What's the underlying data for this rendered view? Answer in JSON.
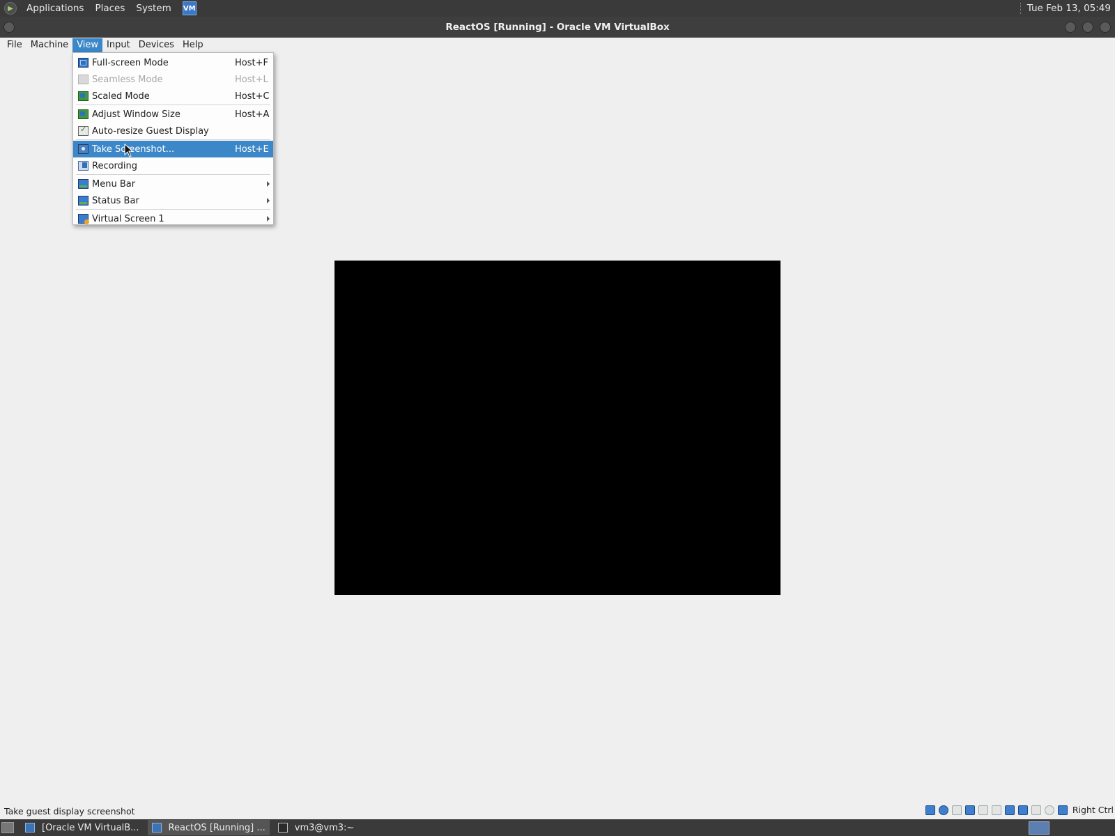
{
  "top_panel": {
    "menus": [
      "Applications",
      "Places",
      "System"
    ],
    "clock": "Tue Feb 13, 05:49"
  },
  "window": {
    "title": "ReactOS [Running] - Oracle VM VirtualBox"
  },
  "menubar": {
    "items": [
      "File",
      "Machine",
      "View",
      "Input",
      "Devices",
      "Help"
    ],
    "active": "View"
  },
  "view_menu": {
    "items": [
      {
        "label": "Full-screen Mode",
        "shortcut": "Host+F",
        "icon": "fullscreen-icon"
      },
      {
        "label": "Seamless Mode",
        "shortcut": "Host+L",
        "icon": "seamless-icon",
        "disabled": true
      },
      {
        "label": "Scaled Mode",
        "shortcut": "Host+C",
        "icon": "scaled-icon"
      },
      {
        "label": "Adjust Window Size",
        "shortcut": "Host+A",
        "icon": "adjust-window-icon"
      },
      {
        "label": "Auto-resize Guest Display",
        "shortcut": "",
        "icon": "auto-resize-icon"
      },
      {
        "label": "Take Screenshot...",
        "shortcut": "Host+E",
        "icon": "screenshot-icon",
        "highlighted": true
      },
      {
        "label": "Recording",
        "shortcut": "",
        "icon": "recording-icon"
      },
      {
        "label": "Menu Bar",
        "shortcut": "",
        "icon": "menu-bar-icon",
        "submenu": true
      },
      {
        "label": "Status Bar",
        "shortcut": "",
        "icon": "status-bar-icon",
        "submenu": true
      },
      {
        "label": "Virtual Screen 1",
        "shortcut": "",
        "icon": "virtual-screen-icon",
        "submenu": true
      }
    ]
  },
  "statusbar": {
    "text": "Take guest display screenshot",
    "host_key": "Right Ctrl"
  },
  "taskbar": {
    "tasks": [
      {
        "label": "[Oracle VM VirtualB...",
        "active": false
      },
      {
        "label": "ReactOS [Running] ...",
        "active": true
      },
      {
        "label": "vm3@vm3:~",
        "active": false
      }
    ]
  },
  "colors": {
    "accent": "#3c87c8",
    "panel": "#3a3a3a",
    "window_bg": "#efefef"
  }
}
